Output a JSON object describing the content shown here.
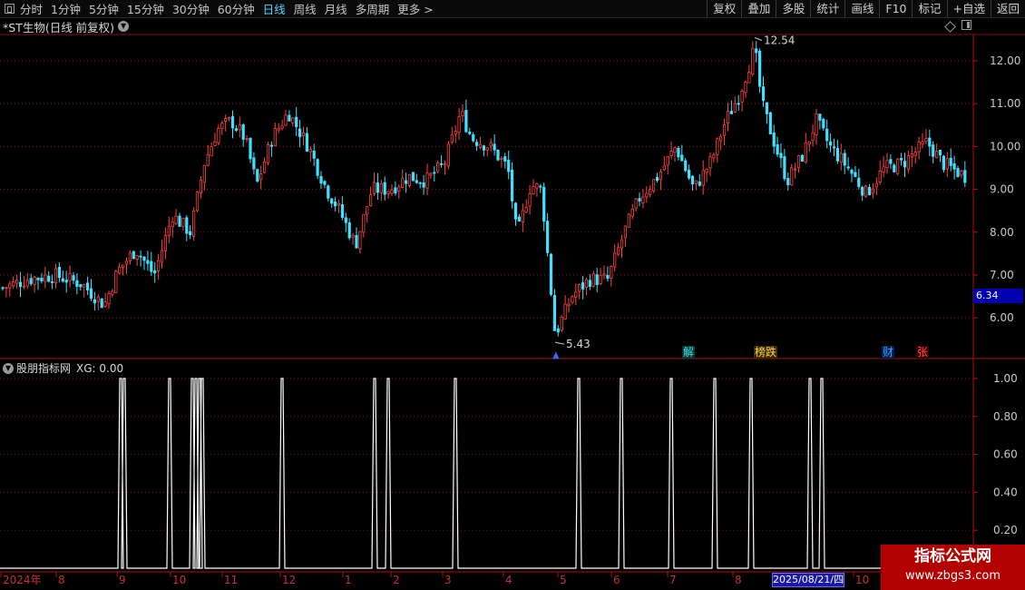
{
  "toolbar": {
    "periods": [
      {
        "label": "分时",
        "active": false
      },
      {
        "label": "1分钟",
        "active": false
      },
      {
        "label": "5分钟",
        "active": false
      },
      {
        "label": "15分钟",
        "active": false
      },
      {
        "label": "30分钟",
        "active": false
      },
      {
        "label": "60分钟",
        "active": false
      },
      {
        "label": "日线",
        "active": true
      },
      {
        "label": "周线",
        "active": false
      },
      {
        "label": "月线",
        "active": false
      },
      {
        "label": "多周期",
        "active": false
      },
      {
        "label": "更多 >",
        "active": false
      }
    ],
    "right_buttons": [
      "复权",
      "叠加",
      "多股",
      "统计",
      "画线",
      "F10",
      "标记",
      "+自选",
      "返回"
    ]
  },
  "main_chart": {
    "title": "*ST生物(日线 前复权)",
    "price_labels": [
      "12.00",
      "11.00",
      "10.00",
      "9.00",
      "8.00",
      "7.00",
      "6.00"
    ],
    "current_price": "6.34",
    "high_label": "12.54",
    "low_label": "5.43",
    "signals": [
      {
        "text": "解",
        "color": "#40e0e0"
      },
      {
        "text": "榜跌",
        "color": "#ffd24a"
      },
      {
        "text": "财",
        "color": "#40a0ff"
      },
      {
        "text": "张",
        "color": "#ff5050"
      }
    ]
  },
  "indicator": {
    "title": "股朋指标网",
    "value_text": "XG: 0.00",
    "axis_labels": [
      "1.00",
      "0.80",
      "0.60",
      "0.40",
      "0.20"
    ]
  },
  "time_axis": {
    "labels": [
      "2024年",
      "8",
      "9",
      "10",
      "11",
      "12",
      "1",
      "2",
      "3",
      "4",
      "5",
      "6",
      "7",
      "8",
      "10"
    ],
    "cursor_date": "2025/08/21/四"
  },
  "watermark": {
    "title": "指标公式网",
    "url": "www.zbgs3.com"
  },
  "colors": {
    "up": "#ff4040",
    "down": "#40e0ff",
    "grid": "#8a1010",
    "accent": "#4fd8ff"
  }
}
